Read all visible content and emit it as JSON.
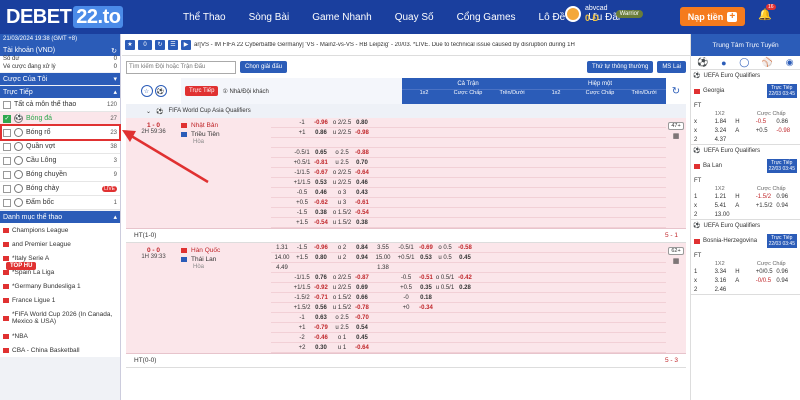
{
  "header": {
    "logo": "DEBET",
    "logo_num": "22.to",
    "nav": [
      "Thể Thao",
      "Sòng Bài",
      "Game Nhanh",
      "Quay Số",
      "Cổng Games",
      "Lô Đề",
      "Ưu Đãi"
    ],
    "user": "abvcad",
    "balance": "0 Đ",
    "rank": "Warrior",
    "deposit": "Nạp tiền",
    "notif": "16",
    "colors": {
      "primary": "#1a3f9e",
      "accent": "#f57b1d"
    }
  },
  "sidebar": {
    "datetime": "21/03/2024 19:38 (GMT +8)",
    "account_label": "Tài khoản (VND)",
    "account_icon": "refresh-icon",
    "rows": [
      {
        "label": "Số dư",
        "value": "0"
      },
      {
        "label": "Vé cược đang xử lý",
        "value": "0"
      }
    ],
    "my_bets": "Cược Của Tôi",
    "live": "Trực Tiếp",
    "items": [
      {
        "label": "Tất cả môn thể thao",
        "count": "120"
      },
      {
        "label": "Bóng đá",
        "count": "27",
        "checked": true
      },
      {
        "label": "Bóng rổ",
        "count": "23"
      },
      {
        "label": "Quần vợt",
        "count": "38"
      },
      {
        "label": "Cầu Lông",
        "count": "3"
      },
      {
        "label": "Bóng chuyền",
        "count": "9"
      },
      {
        "label": "Bóng chày",
        "count": "LIVE"
      },
      {
        "label": "Đấm bốc",
        "count": "1"
      }
    ],
    "top_hu": "TOP HŨ",
    "category": "Danh mục thể thao",
    "leagues": [
      "Champions League",
      "and Premier League",
      "*Italy Serie A",
      "*Spain La Liga",
      "*Germany Bundesliga 1",
      "France Ligue 1",
      "*FIFA World Cup 2026 (In Canada, Mexico & USA)",
      "*NBA",
      "CBA - China Basketball"
    ]
  },
  "ticker": {
    "count": "0",
    "text": "ar[VS - IM FIFA 22 Cyberbattle Germany] 'VS - Mainz-vs-VS - RB Leipzig' - 20/03. *LIVE. Due to technical issue caused by disruption during 1H"
  },
  "filters": {
    "search_placeholder": "Tìm kiếm Đội hoặc Trận Đấu",
    "choose_league": "Chọn giải đấu",
    "sort": "Thứ tự thông thường",
    "odds_type": "MS Lai"
  },
  "table": {
    "live_tag": "Trực Tiếp",
    "hdp_label": "① Nhà/Đội khách",
    "full_match": "Cả Trận",
    "half": "Hiệp một",
    "cols": [
      "1x2",
      "Cược Chấp",
      "Trên/Dưới",
      "1x2",
      "Cược Chấp",
      "Trên/Dưới"
    ],
    "league": "FIFA World Cup Asia Qualifiers"
  },
  "matches": [
    {
      "score": "1 - 0",
      "time": "2H 59:36",
      "home": "Nhật Bản",
      "away": "Triều Tiên",
      "draw": "Hòa",
      "more": "47+",
      "rows": [
        [
          "",
          "-1",
          "-0.96",
          "o 2/2.5",
          "0.80",
          "",
          "",
          "",
          "",
          ""
        ],
        [
          "",
          "+1",
          "0.86",
          "u 2/2.5",
          "-0.98",
          "",
          "",
          "",
          "",
          ""
        ],
        [
          "",
          "",
          "",
          "",
          "",
          "",
          "",
          "",
          "",
          ""
        ],
        [
          "",
          "-0.5/1",
          "0.65",
          "o 2.5",
          "-0.88",
          "",
          "",
          "",
          "",
          ""
        ],
        [
          "",
          "+0.5/1",
          "-0.81",
          "u 2.5",
          "0.70",
          "",
          "",
          "",
          "",
          ""
        ],
        [
          "",
          "-1/1.5",
          "-0.67",
          "o 2/2.5",
          "-0.64",
          "",
          "",
          "",
          "",
          ""
        ],
        [
          "",
          "+1/1.5",
          "0.53",
          "u 2/2.5",
          "0.46",
          "",
          "",
          "",
          "",
          ""
        ],
        [
          "",
          "-0.5",
          "0.46",
          "o 3",
          "0.43",
          "",
          "",
          "",
          "",
          ""
        ],
        [
          "",
          "+0.5",
          "-0.62",
          "u 3",
          "-0.61",
          "",
          "",
          "",
          "",
          ""
        ],
        [
          "",
          "-1.5",
          "0.38",
          "o 1.5/2",
          "-0.54",
          "",
          "",
          "",
          "",
          ""
        ],
        [
          "",
          "+1.5",
          "-0.54",
          "u 1.5/2",
          "0.38",
          "",
          "",
          "",
          "",
          ""
        ]
      ],
      "ht": "HT(1-0)",
      "ht_r": "5 - 1"
    },
    {
      "score": "0 - 0",
      "time": "1H 39:33",
      "home": "Hàn Quốc",
      "away": "Thái Lan",
      "draw": "Hòa",
      "more": "62+",
      "rows": [
        [
          "1.31",
          "-1.5",
          "-0.96",
          "o 2",
          "0.84",
          "3.55",
          "-0.5/1",
          "-0.69",
          "o 0.5",
          "-0.58"
        ],
        [
          "14.00",
          "+1.5",
          "0.80",
          "u 2",
          "0.94",
          "15.00",
          "+0.5/1",
          "0.53",
          "u 0.5",
          "0.45"
        ],
        [
          "4.49",
          "",
          "",
          "",
          "",
          "1.38",
          "",
          "",
          "",
          ""
        ],
        [
          "",
          "-1/1.5",
          "0.76",
          "o 2/2.5",
          "-0.87",
          "",
          "-0.5",
          "-0.51",
          "o 0.5/1",
          "-0.42"
        ],
        [
          "",
          "+1/1.5",
          "-0.92",
          "u 2/2.5",
          "0.69",
          "",
          "+0.5",
          "0.35",
          "u 0.5/1",
          "0.28"
        ],
        [
          "",
          "-1.5/2",
          "-0.71",
          "o 1.5/2",
          "0.66",
          "",
          "-0",
          "0.18",
          "",
          ""
        ],
        [
          "",
          "+1.5/2",
          "0.56",
          "u 1.5/2",
          "-0.78",
          "",
          "+0",
          "-0.34",
          "",
          ""
        ],
        [
          "",
          "-1",
          "0.63",
          "o 2.5",
          "-0.70",
          "",
          "",
          "",
          "",
          ""
        ],
        [
          "",
          "+1",
          "-0.79",
          "u 2.5",
          "0.54",
          "",
          "",
          "",
          "",
          ""
        ],
        [
          "",
          "-2",
          "-0.46",
          "o 1",
          "0.45",
          "",
          "",
          "",
          "",
          ""
        ],
        [
          "",
          "+2",
          "0.30",
          "u 1",
          "-0.64",
          "",
          "",
          "",
          "",
          ""
        ]
      ],
      "ht": "HT(0-0)",
      "ht_r": "5 - 3"
    }
  ],
  "right": {
    "title": "Trung Tâm Trực Tuyến",
    "cards": [
      {
        "league": "UEFA Euro Qualifiers",
        "team": "Georgia",
        "tag": "Trực Tiếp",
        "date": "22/03 03:45",
        "ft": "FT",
        "odds": [
          [
            "x",
            "1.84",
            "H",
            "-0.5",
            "0.86"
          ],
          [
            "x",
            "3.24",
            "A",
            "+0.5",
            "-0.98"
          ],
          [
            "2",
            "4.37",
            "",
            "",
            ""
          ]
        ]
      },
      {
        "league": "UEFA Euro Qualifiers",
        "team": "Ba Lan",
        "tag": "Trực Tiếp",
        "date": "22/03 03:45",
        "ft": "FT",
        "odds": [
          [
            "1",
            "1.21",
            "H",
            "-1.5/2",
            "0.96"
          ],
          [
            "x",
            "5.41",
            "A",
            "+1.5/2",
            "0.94"
          ],
          [
            "2",
            "13.00",
            "",
            "",
            ""
          ]
        ]
      },
      {
        "league": "UEFA Euro Qualifiers",
        "team": "Bosnia-Herzegovina",
        "tag": "Trực Tiếp",
        "date": "22/03 03:45",
        "ft": "FT",
        "odds": [
          [
            "1",
            "3.34",
            "H",
            "+0/0.5",
            "0.96"
          ],
          [
            "x",
            "3.16",
            "A",
            "-0/0.5",
            "0.94"
          ],
          [
            "2",
            "2.46",
            "",
            "",
            ""
          ]
        ]
      }
    ],
    "odds_head": [
      "1X2",
      "Cược Chấp"
    ]
  }
}
